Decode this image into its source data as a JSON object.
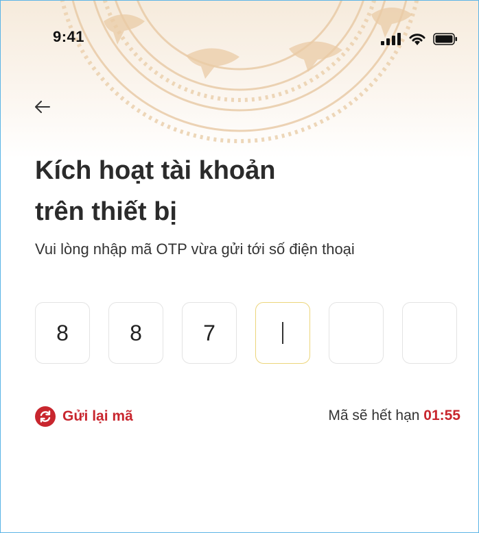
{
  "status_bar": {
    "time": "9:41"
  },
  "header": {
    "title_line1": "Kích hoạt tài khoản",
    "title_line2": "trên thiết bị",
    "subtitle": "Vui lòng nhập mã OTP vừa gửi tới số điện thoại"
  },
  "otp": {
    "digits": [
      "8",
      "8",
      "7",
      "",
      "",
      ""
    ],
    "active_index": 3,
    "active_border_color": "#ecd57a"
  },
  "resend": {
    "label": "Gửi lại mã"
  },
  "expiry": {
    "label": "Mã sẽ hết hạn",
    "time": "01:55"
  },
  "colors": {
    "accent": "#c8262e",
    "background_tint": "#f6ebdc"
  },
  "icons": {
    "back": "arrow-left-icon",
    "resend": "refresh-icon",
    "signal": "cellular-signal-icon",
    "wifi": "wifi-icon",
    "battery": "battery-icon"
  }
}
